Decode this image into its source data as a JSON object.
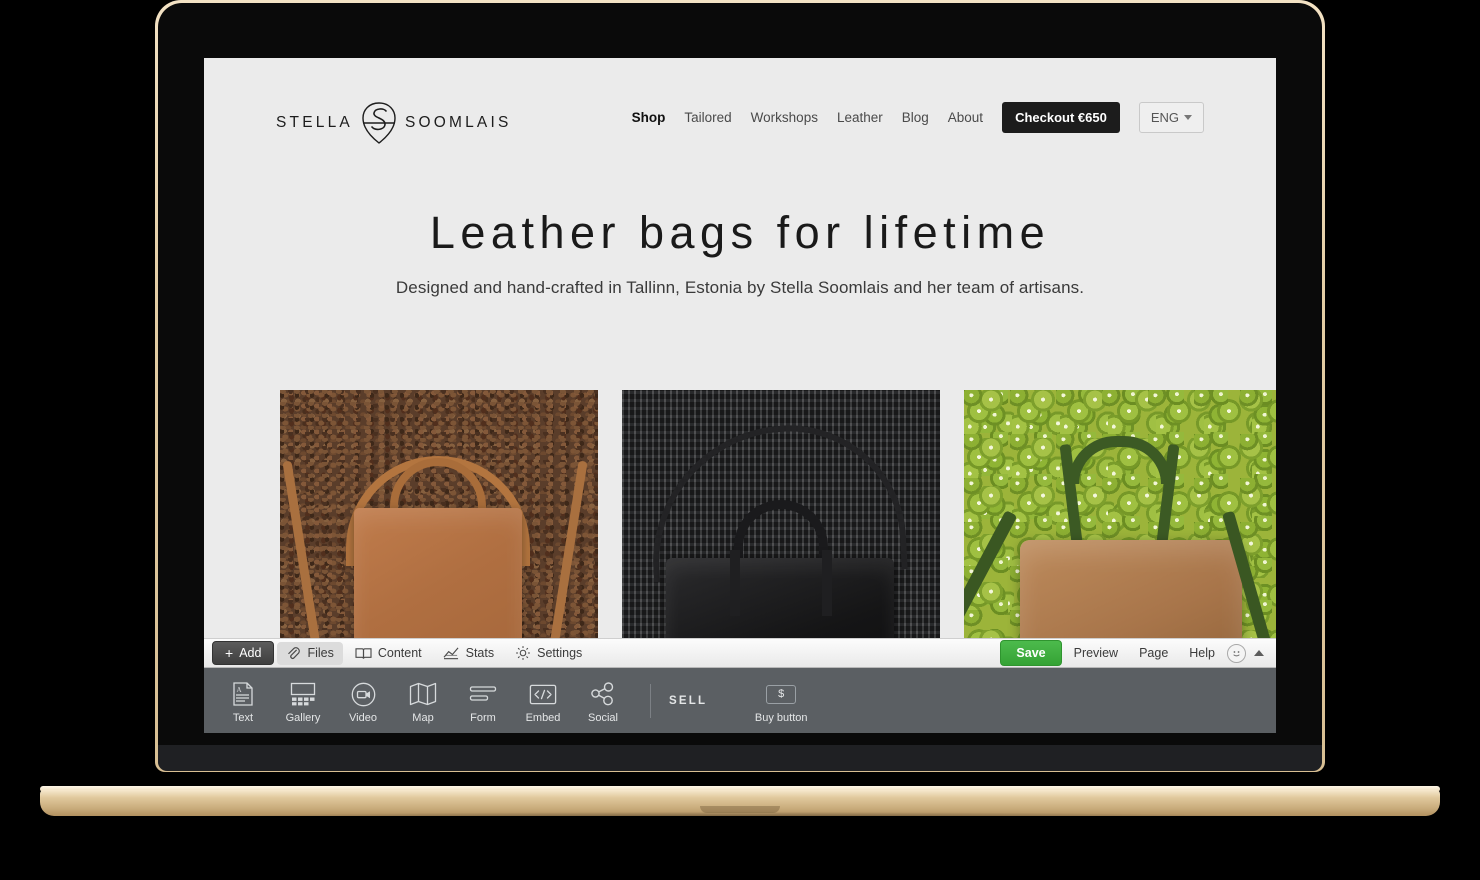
{
  "site": {
    "logo": {
      "word_left": "STELLA",
      "word_right": "SOOMLAIS",
      "mark": "stella-s-shield-mark"
    },
    "nav": [
      {
        "label": "Shop",
        "active": true
      },
      {
        "label": "Tailored",
        "active": false
      },
      {
        "label": "Workshops",
        "active": false
      },
      {
        "label": "Leather",
        "active": false
      },
      {
        "label": "Blog",
        "active": false
      },
      {
        "label": "About",
        "active": false
      }
    ],
    "checkout": {
      "label": "Checkout €650"
    },
    "language": {
      "label": "ENG",
      "caret": "chevron-down-icon"
    },
    "hero": {
      "headline": "Leather bags for lifetime",
      "subhead": "Designed and hand-crafted in Tallinn, Estonia by Stella Soomlais and her team of artisans."
    },
    "products": [
      {
        "name": "tan-leather-backpack-on-coffee-beans",
        "alt": "Tan leather backpack on coffee bean backdrop"
      },
      {
        "name": "black-leather-bag-on-dark-weave",
        "alt": "Black leather shoulder bag on dark woven backdrop"
      },
      {
        "name": "brown-duffel-green-straps-on-kiwi",
        "alt": "Brown leather duffel with green straps on kiwi slice backdrop"
      }
    ]
  },
  "editor": {
    "toolbar_left": [
      {
        "label": "Add",
        "icon": "plus-icon",
        "style": "dark"
      },
      {
        "label": "Files",
        "icon": "paperclip-icon",
        "style": "highlight"
      },
      {
        "label": "Content",
        "icon": "book-icon",
        "style": "plain"
      },
      {
        "label": "Stats",
        "icon": "chart-icon",
        "style": "plain"
      },
      {
        "label": "Settings",
        "icon": "gear-icon",
        "style": "plain"
      }
    ],
    "toolbar_right": {
      "save": "Save",
      "preview": "Preview",
      "page": "Page",
      "help": "Help",
      "avatar": "smiley-avatar-icon",
      "collapse": "chevron-up-icon"
    },
    "widgets": [
      {
        "label": "Text",
        "icon": "text-document-icon"
      },
      {
        "label": "Gallery",
        "icon": "gallery-grid-icon"
      },
      {
        "label": "Video",
        "icon": "video-camera-icon"
      },
      {
        "label": "Map",
        "icon": "folded-map-icon"
      },
      {
        "label": "Form",
        "icon": "form-lines-icon"
      },
      {
        "label": "Embed",
        "icon": "code-embed-icon"
      },
      {
        "label": "Social",
        "icon": "share-nodes-icon"
      }
    ],
    "sell_section": {
      "title": "SELL",
      "items": [
        {
          "label": "Buy button",
          "icon": "dollar-button-icon"
        }
      ]
    }
  },
  "colors": {
    "page_bg": "#ebebeb",
    "checkout_bg": "#1c1c1c",
    "save_green": "#3fae3f",
    "widget_bar": "#5b5f63",
    "laptop_gold": "#e0c89c"
  }
}
